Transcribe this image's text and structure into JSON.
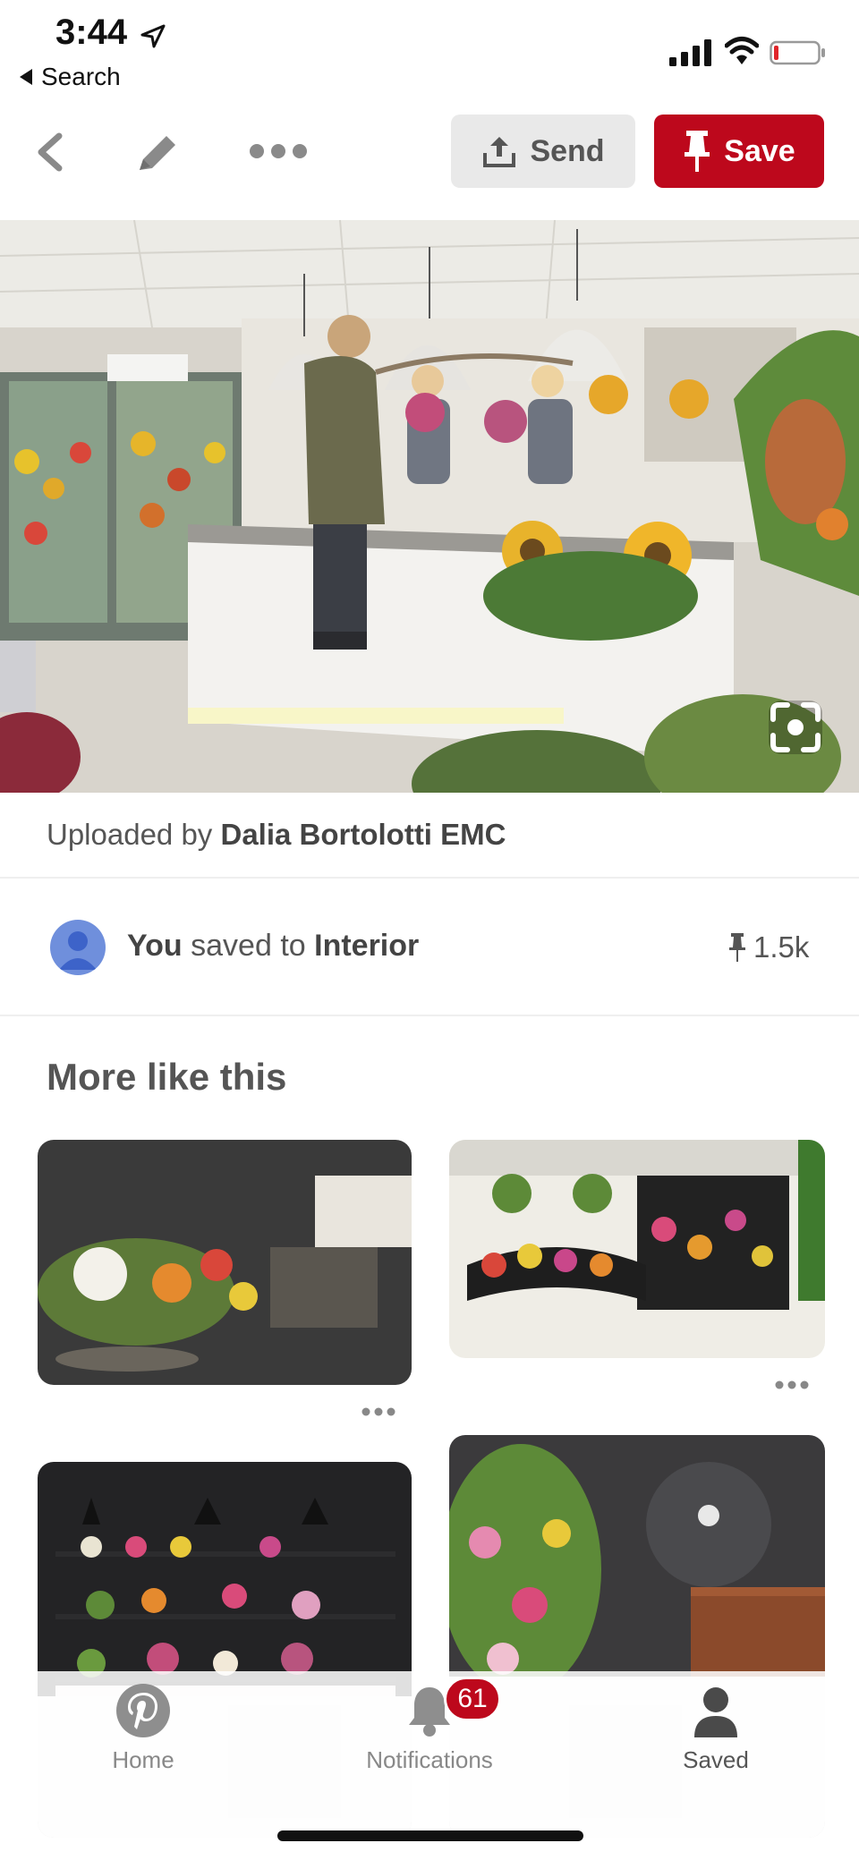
{
  "status_bar": {
    "time": "3:44",
    "back_label": "Search"
  },
  "toolbar": {
    "send_label": "Send",
    "save_label": "Save"
  },
  "pin": {
    "uploaded_prefix": "Uploaded by ",
    "uploader": "Dalia Bortolotti EMC",
    "saved_you": "You",
    "saved_middle": " saved to ",
    "saved_board": "Interior",
    "save_count": "1.5k"
  },
  "more_like_this": {
    "title": "More like this"
  },
  "tabbar": {
    "home_label": "Home",
    "notifications_label": "Notifications",
    "notifications_badge": "61",
    "saved_label": "Saved"
  },
  "colors": {
    "brand_red": "#bd081c",
    "send_bg": "#e9e9e9"
  }
}
